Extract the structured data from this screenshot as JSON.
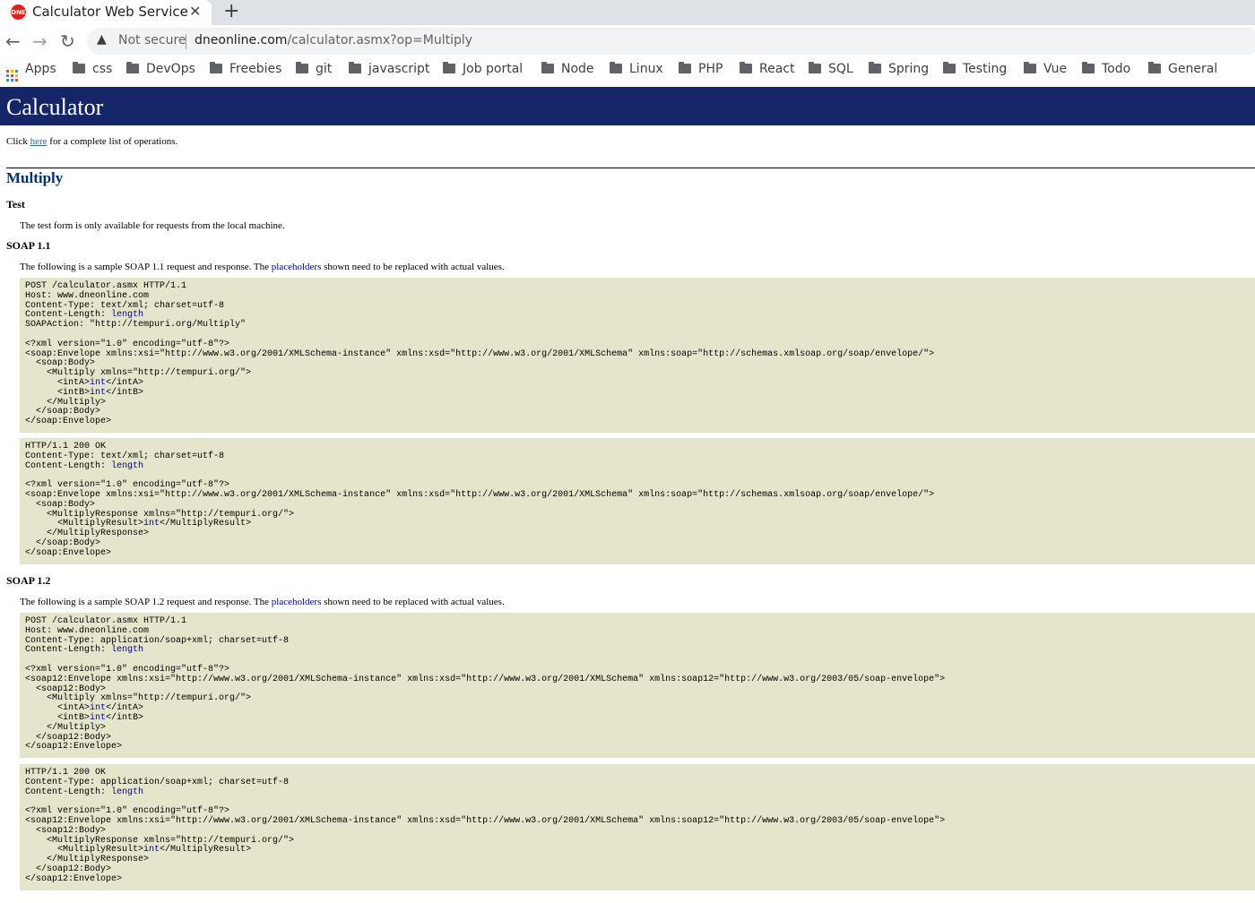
{
  "browser": {
    "tab": {
      "title": "Calculator Web Service",
      "favicon_text": "DNE",
      "close_glyph": "✕"
    },
    "newtab_glyph": "+",
    "nav": {
      "back": "←",
      "forward": "→",
      "reload": "↻"
    },
    "security": {
      "icon": "warning-triangle-icon",
      "glyph": "▲",
      "label": "Not secure"
    },
    "url": {
      "host": "dneonline.com",
      "path": "/calculator.asmx?op=Multiply"
    },
    "bookmarks": [
      {
        "label": "Apps",
        "icon": "apps-grid-icon"
      },
      {
        "label": "css",
        "icon": "folder-icon"
      },
      {
        "label": "DevOps",
        "icon": "folder-icon"
      },
      {
        "label": "Freebies",
        "icon": "folder-icon"
      },
      {
        "label": "git",
        "icon": "folder-icon"
      },
      {
        "label": "javascript",
        "icon": "folder-icon"
      },
      {
        "label": "Job portal",
        "icon": "folder-icon"
      },
      {
        "label": "Node",
        "icon": "folder-icon"
      },
      {
        "label": "Linux",
        "icon": "folder-icon"
      },
      {
        "label": "PHP",
        "icon": "folder-icon"
      },
      {
        "label": "React",
        "icon": "folder-icon"
      },
      {
        "label": "SQL",
        "icon": "folder-icon"
      },
      {
        "label": "Spring",
        "icon": "folder-icon"
      },
      {
        "label": "Testing",
        "icon": "folder-icon"
      },
      {
        "label": "Vue",
        "icon": "folder-icon"
      },
      {
        "label": "Todo",
        "icon": "folder-icon"
      },
      {
        "label": "General",
        "icon": "folder-icon"
      }
    ]
  },
  "page": {
    "banner_title": "Calculator",
    "intro": {
      "before": "Click ",
      "link": "here",
      "after": " for a complete list of operations."
    },
    "operation_title": "Multiply",
    "test": {
      "heading": "Test",
      "text": "The test form is only available for requests from the local machine."
    },
    "soap11": {
      "heading": "SOAP 1.1",
      "para_before": "The following is a sample SOAP 1.1 request and response. The ",
      "para_link": "placeholders",
      "para_after": " shown need to be replaced with actual values.",
      "request": [
        [
          "POST /calculator.asmx HTTP/1.1"
        ],
        [
          "Host: www.dneonline.com"
        ],
        [
          "Content-Type: text/xml; charset=utf-8"
        ],
        [
          "Content-Length: ",
          {
            "ph": "length"
          }
        ],
        [
          "SOAPAction: \"http://tempuri.org/Multiply\""
        ],
        [
          ""
        ],
        [
          "<?xml version=\"1.0\" encoding=\"utf-8\"?>"
        ],
        [
          "<soap:Envelope xmlns:xsi=\"http://www.w3.org/2001/XMLSchema-instance\" xmlns:xsd=\"http://www.w3.org/2001/XMLSchema\" xmlns:soap=\"http://schemas.xmlsoap.org/soap/envelope/\">"
        ],
        [
          "  <soap:Body>"
        ],
        [
          "    <Multiply xmlns=\"http://tempuri.org/\">"
        ],
        [
          "      <intA>",
          {
            "ph": "int"
          },
          "</intA>"
        ],
        [
          "      <intB>",
          {
            "ph": "int"
          },
          "</intB>"
        ],
        [
          "    </Multiply>"
        ],
        [
          "  </soap:Body>"
        ],
        [
          "</soap:Envelope>"
        ]
      ],
      "response": [
        [
          "HTTP/1.1 200 OK"
        ],
        [
          "Content-Type: text/xml; charset=utf-8"
        ],
        [
          "Content-Length: ",
          {
            "ph": "length"
          }
        ],
        [
          ""
        ],
        [
          "<?xml version=\"1.0\" encoding=\"utf-8\"?>"
        ],
        [
          "<soap:Envelope xmlns:xsi=\"http://www.w3.org/2001/XMLSchema-instance\" xmlns:xsd=\"http://www.w3.org/2001/XMLSchema\" xmlns:soap=\"http://schemas.xmlsoap.org/soap/envelope/\">"
        ],
        [
          "  <soap:Body>"
        ],
        [
          "    <MultiplyResponse xmlns=\"http://tempuri.org/\">"
        ],
        [
          "      <MultiplyResult>",
          {
            "ph": "int"
          },
          "</MultiplyResult>"
        ],
        [
          "    </MultiplyResponse>"
        ],
        [
          "  </soap:Body>"
        ],
        [
          "</soap:Envelope>"
        ]
      ]
    },
    "soap12": {
      "heading": "SOAP 1.2",
      "para_before": "The following is a sample SOAP 1.2 request and response. The ",
      "para_link": "placeholders",
      "para_after": " shown need to be replaced with actual values.",
      "request": [
        [
          "POST /calculator.asmx HTTP/1.1"
        ],
        [
          "Host: www.dneonline.com"
        ],
        [
          "Content-Type: application/soap+xml; charset=utf-8"
        ],
        [
          "Content-Length: ",
          {
            "ph": "length"
          }
        ],
        [
          ""
        ],
        [
          "<?xml version=\"1.0\" encoding=\"utf-8\"?>"
        ],
        [
          "<soap12:Envelope xmlns:xsi=\"http://www.w3.org/2001/XMLSchema-instance\" xmlns:xsd=\"http://www.w3.org/2001/XMLSchema\" xmlns:soap12=\"http://www.w3.org/2003/05/soap-envelope\">"
        ],
        [
          "  <soap12:Body>"
        ],
        [
          "    <Multiply xmlns=\"http://tempuri.org/\">"
        ],
        [
          "      <intA>",
          {
            "ph": "int"
          },
          "</intA>"
        ],
        [
          "      <intB>",
          {
            "ph": "int"
          },
          "</intB>"
        ],
        [
          "    </Multiply>"
        ],
        [
          "  </soap12:Body>"
        ],
        [
          "</soap12:Envelope>"
        ]
      ],
      "response": [
        [
          "HTTP/1.1 200 OK"
        ],
        [
          "Content-Type: application/soap+xml; charset=utf-8"
        ],
        [
          "Content-Length: ",
          {
            "ph": "length"
          }
        ],
        [
          ""
        ],
        [
          "<?xml version=\"1.0\" encoding=\"utf-8\"?>"
        ],
        [
          "<soap12:Envelope xmlns:xsi=\"http://www.w3.org/2001/XMLSchema-instance\" xmlns:xsd=\"http://www.w3.org/2001/XMLSchema\" xmlns:soap12=\"http://www.w3.org/2003/05/soap-envelope\">"
        ],
        [
          "  <soap12:Body>"
        ],
        [
          "    <MultiplyResponse xmlns=\"http://tempuri.org/\">"
        ],
        [
          "      <MultiplyResult>",
          {
            "ph": "int"
          },
          "</MultiplyResult>"
        ],
        [
          "    </MultiplyResponse>"
        ],
        [
          "  </soap12:Body>"
        ],
        [
          "</soap12:Envelope>"
        ]
      ]
    }
  },
  "colors": {
    "banner": "#142568",
    "code_bg": "#e5e5cc",
    "placeholder": "#000099",
    "link": "#336699",
    "title": "#003366"
  }
}
